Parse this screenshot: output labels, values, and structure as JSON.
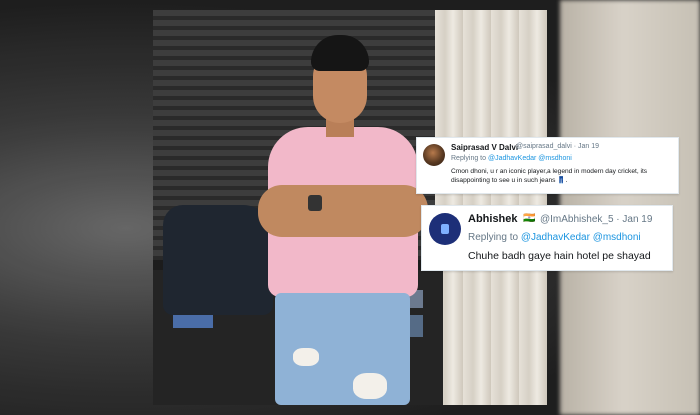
{
  "tweets": [
    {
      "name": "Saiprasad V Dalvi",
      "meta": "@saiprasad_dalvi · Jan 19",
      "reply_prefix": "Replying to ",
      "mention1": "@JadhavKedar",
      "mention2": "@msdhoni",
      "text": "Cmon dhoni, u r an iconic player,a legend in modern day cricket, its disappointing to see u in such jeans ",
      "emoji": "👖"
    },
    {
      "name": "Abhishek",
      "flag": "🇮🇳",
      "meta": "@ImAbhishek_5 · Jan 19",
      "reply_prefix": "Replying to ",
      "mention1": "@JadhavKedar",
      "mention2": "@msdhoni",
      "text": "Chuhe badh gaye hain hotel pe shayad"
    }
  ]
}
